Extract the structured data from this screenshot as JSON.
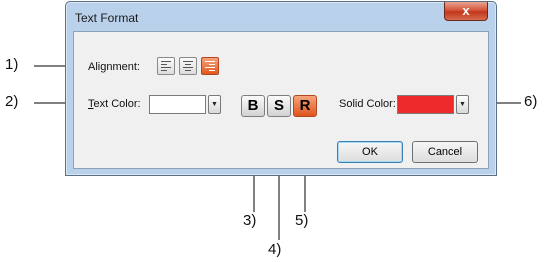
{
  "dialog": {
    "title": "Text Format",
    "close_glyph": "x",
    "alignment_label": "Alignment:",
    "alignment_buttons": [
      {
        "icon": "align-left-icon",
        "active": false
      },
      {
        "icon": "align-center-icon",
        "active": false
      },
      {
        "icon": "align-right-icon",
        "active": true
      }
    ],
    "text_color_label": "Text Color:",
    "text_color_value": "#ffffff",
    "format_buttons": [
      {
        "label": "B",
        "active": false
      },
      {
        "label": "S",
        "active": false
      },
      {
        "label": "R",
        "active": true
      }
    ],
    "solid_color_label": "Solid Color:",
    "solid_color_value": "#ee2b2b",
    "dropdown_glyph": "▼",
    "ok_label": "OK",
    "cancel_label": "Cancel",
    "accent_color": "#e1581f"
  },
  "callouts": [
    "1)",
    "2)",
    "3)",
    "4)",
    "5)",
    "6)"
  ]
}
